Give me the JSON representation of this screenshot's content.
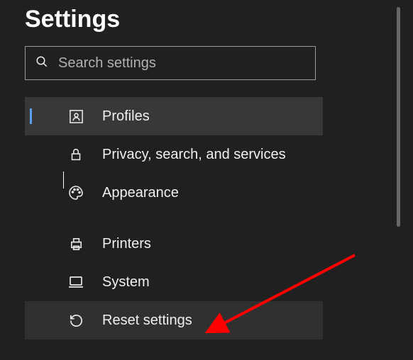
{
  "page": {
    "title": "Settings"
  },
  "search": {
    "placeholder": "Search settings",
    "value": ""
  },
  "sidebar": {
    "items": [
      {
        "id": "profiles",
        "label": "Profiles",
        "icon": "person-rect-icon",
        "active": true
      },
      {
        "id": "privacy",
        "label": "Privacy, search, and services",
        "icon": "lock-icon"
      },
      {
        "id": "appearance",
        "label": "Appearance",
        "icon": "palette-icon"
      },
      {
        "id": "printers",
        "label": "Printers",
        "icon": "printer-icon"
      },
      {
        "id": "system",
        "label": "System",
        "icon": "laptop-icon"
      },
      {
        "id": "reset",
        "label": "Reset settings",
        "icon": "reset-icon",
        "highlighted": true
      }
    ]
  },
  "annotation": {
    "type": "arrow",
    "color": "#ff0000"
  }
}
